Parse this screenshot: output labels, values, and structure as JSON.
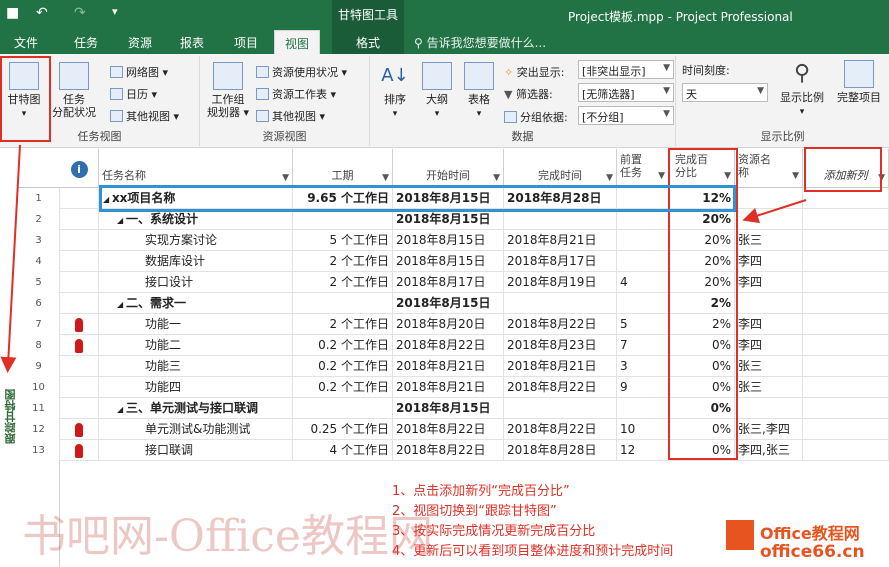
{
  "window": {
    "title": "Project模板.mpp - Project Professional",
    "context_tab_group": "甘特图工具",
    "quick_access": [
      "save-icon",
      "undo-icon",
      "redo-icon",
      "customize-icon"
    ]
  },
  "tabs": {
    "file": "文件",
    "task": "任务",
    "resource": "资源",
    "report": "报表",
    "project": "项目",
    "view": "视图",
    "format": "格式",
    "tell_me": "告诉我您想要做什么..."
  },
  "ribbon": {
    "task_views": {
      "label": "任务视图",
      "gantt": "甘特图",
      "task_usage": "任务\n分配状况",
      "network": "网络图",
      "calendar": "日历",
      "other_views": "其他视图"
    },
    "resource_views": {
      "label": "资源视图",
      "team_planner": "工作组\n规划器",
      "resource_usage": "资源使用状况",
      "resource_sheet": "资源工作表",
      "other_views": "其他视图"
    },
    "data": {
      "label": "数据",
      "sort": "排序",
      "outline": "大纲",
      "tables": "表格",
      "highlight_label": "突出显示:",
      "highlight_value": "[非突出显示]",
      "filter_label": "筛选器:",
      "filter_value": "[无筛选器]",
      "group_label": "分组依据:",
      "group_value": "[不分组]"
    },
    "zoom": {
      "label": "显示比例",
      "timescale_label": "时间刻度:",
      "timescale_value": "天",
      "zoom": "显示比例",
      "entire_project": "完整项目"
    }
  },
  "left_bar": {
    "view_name": "跟踪甘特图"
  },
  "table": {
    "headers": {
      "info": "i",
      "name": "任务名称",
      "duration": "工期",
      "start": "开始时间",
      "finish": "完成时间",
      "predecessors": "前置\n任务",
      "percent_complete": "完成百\n分比",
      "resources": "资源名\n称",
      "add_column": "添加新列"
    },
    "rows": [
      {
        "id": "1",
        "indicator": "",
        "name": "xx项目名称",
        "duration": "9.65 个工作日",
        "start": "2018年8月15日",
        "finish": "2018年8月28日",
        "pred": "",
        "pct": "12%",
        "res": "",
        "level": 0,
        "summary": true
      },
      {
        "id": "2",
        "indicator": "",
        "name": "一、系统设计",
        "duration": "",
        "start": "2018年8月15日",
        "finish": "",
        "pred": "",
        "pct": "20%",
        "res": "",
        "level": 1,
        "summary": true
      },
      {
        "id": "3",
        "indicator": "",
        "name": "实现方案讨论",
        "duration": "5 个工作日",
        "start": "2018年8月15日",
        "finish": "2018年8月21日",
        "pred": "",
        "pct": "20%",
        "res": "张三",
        "level": 2,
        "summary": false
      },
      {
        "id": "4",
        "indicator": "",
        "name": "数据库设计",
        "duration": "2 个工作日",
        "start": "2018年8月15日",
        "finish": "2018年8月17日",
        "pred": "",
        "pct": "20%",
        "res": "李四",
        "level": 2,
        "summary": false
      },
      {
        "id": "5",
        "indicator": "",
        "name": "接口设计",
        "duration": "2 个工作日",
        "start": "2018年8月17日",
        "finish": "2018年8月19日",
        "pred": "4",
        "pct": "20%",
        "res": "李四",
        "level": 2,
        "summary": false
      },
      {
        "id": "6",
        "indicator": "",
        "name": "二、需求一",
        "duration": "",
        "start": "2018年8月15日",
        "finish": "",
        "pred": "",
        "pct": "2%",
        "res": "",
        "level": 1,
        "summary": true
      },
      {
        "id": "7",
        "indicator": "person",
        "name": "功能一",
        "duration": "2 个工作日",
        "start": "2018年8月20日",
        "finish": "2018年8月22日",
        "pred": "5",
        "pct": "2%",
        "res": "李四",
        "level": 2,
        "summary": false
      },
      {
        "id": "8",
        "indicator": "person",
        "name": "功能二",
        "duration": "0.2 个工作日",
        "start": "2018年8月22日",
        "finish": "2018年8月23日",
        "pred": "7",
        "pct": "0%",
        "res": "李四",
        "level": 2,
        "summary": false
      },
      {
        "id": "9",
        "indicator": "",
        "name": "功能三",
        "duration": "0.2 个工作日",
        "start": "2018年8月21日",
        "finish": "2018年8月21日",
        "pred": "3",
        "pct": "0%",
        "res": "张三",
        "level": 2,
        "summary": false
      },
      {
        "id": "10",
        "indicator": "",
        "name": "功能四",
        "duration": "0.2 个工作日",
        "start": "2018年8月21日",
        "finish": "2018年8月22日",
        "pred": "9",
        "pct": "0%",
        "res": "张三",
        "level": 2,
        "summary": false
      },
      {
        "id": "11",
        "indicator": "",
        "name": "三、单元测试与接口联调",
        "duration": "",
        "start": "2018年8月15日",
        "finish": "",
        "pred": "",
        "pct": "0%",
        "res": "",
        "level": 1,
        "summary": true
      },
      {
        "id": "12",
        "indicator": "person",
        "name": "单元测试&功能测试",
        "duration": "0.25 个工作日",
        "start": "2018年8月22日",
        "finish": "2018年8月22日",
        "pred": "10",
        "pct": "0%",
        "res": "张三,李四",
        "level": 2,
        "summary": false
      },
      {
        "id": "13",
        "indicator": "person",
        "name": "接口联调",
        "duration": "4 个工作日",
        "start": "2018年8月22日",
        "finish": "2018年8月28日",
        "pred": "12",
        "pct": "0%",
        "res": "李四,张三",
        "level": 2,
        "summary": false
      }
    ]
  },
  "annotations": {
    "steps": [
      "1、点击添加新列“完成百分比”",
      "2、视图切换到“跟踪甘特图”",
      "3、按实际完成情况更新完成百分比",
      "4、更新后可以看到项目整体进度和预计完成时间"
    ],
    "highlight_color": "#e03025",
    "box_color": "#2f92d6"
  },
  "watermark": {
    "text": "书吧网-Office教程网",
    "logo_line1": "Office教程网",
    "logo_line2": "office66.cn"
  },
  "colors": {
    "brand": "#217346",
    "brand_dark": "#1a5c38",
    "ribbon_bg": "#f3f3f3"
  }
}
